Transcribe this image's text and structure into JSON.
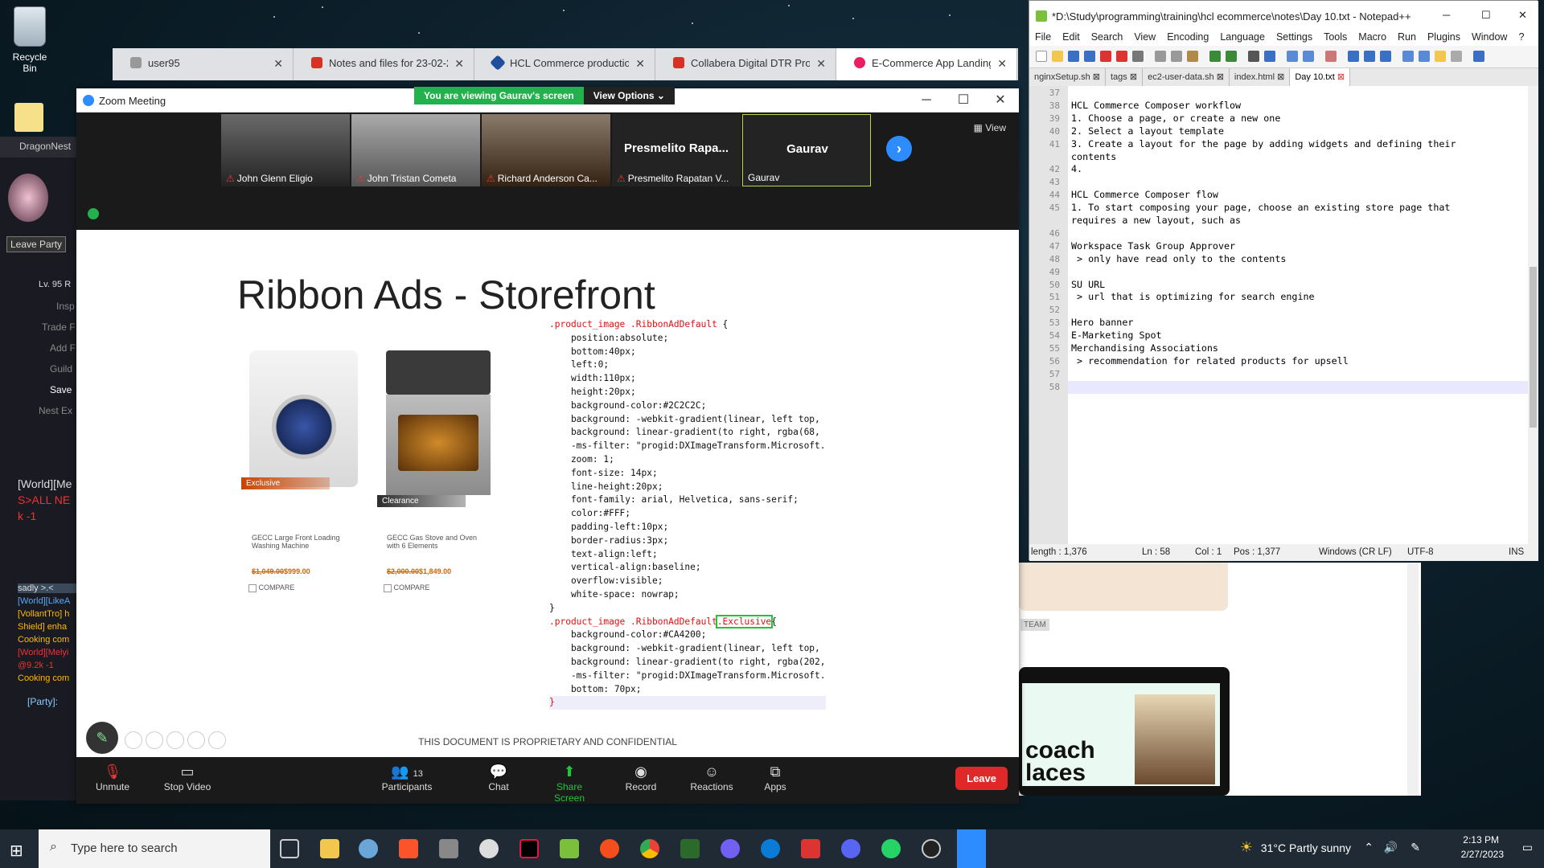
{
  "desktop": {
    "recycle_bin": "Recycle Bin",
    "dragonnest": "DragonNest"
  },
  "game": {
    "leave_party": "Leave Party",
    "level": "Lv. 95 R",
    "menu": [
      "Insp",
      "Trade F",
      "Add F",
      "Guild",
      "Save",
      "Nest Ex"
    ],
    "chat1": "[World][Me",
    "chat2": "S>ALL NE",
    "chat3": "k -1",
    "chat_lines": [
      "sadly >.<",
      "[World][LikeA",
      "[VollantTro] h",
      "Shield] enha",
      "Cooking com",
      "[World][Melyi",
      "@9.2k -1",
      "Cooking com"
    ],
    "party": "[Party]:"
  },
  "browser": {
    "tabs": [
      {
        "label": "user95",
        "color": "#999999"
      },
      {
        "label": "Notes and files for 23-02-2023",
        "color": "#d93025"
      },
      {
        "label": "HCL Commerce production en",
        "color": "#1f4e9c"
      },
      {
        "label": "Collabera Digital DTR Process",
        "color": "#d93025"
      },
      {
        "label": "E-Commerce App Landing He",
        "color": "#e91e63"
      }
    ]
  },
  "zoom": {
    "title": "Zoom Meeting",
    "viewing": "You are viewing Gaurav's screen",
    "view_options": "View Options",
    "view": "View",
    "participants": [
      {
        "name": "John Glenn Eligio",
        "muted": true
      },
      {
        "name": "John Tristan Cometa",
        "muted": true
      },
      {
        "name": "Richard Anderson Ca...",
        "muted": true
      },
      {
        "name": "Presmelito Rapatan V...",
        "big": "Presmelito  Rapa...",
        "muted": true
      },
      {
        "name": "Gaurav",
        "big": "Gaurav",
        "muted": false
      }
    ],
    "controls": {
      "unmute": "Unmute",
      "stop_video": "Stop Video",
      "participants": "Participants",
      "participants_count": "13",
      "chat": "Chat",
      "share_screen": "Share Screen",
      "record": "Record",
      "reactions": "Reactions",
      "apps": "Apps",
      "leave": "Leave"
    }
  },
  "slide": {
    "title": "Ribbon Ads - Storefront",
    "products": [
      {
        "ribbon": "Exclusive",
        "ribbon_color": "#CA4200",
        "name": "GECC Large Front Loading Washing Machine",
        "old_price": "$1,049.00",
        "price": "$999.00",
        "compare": "COMPARE"
      },
      {
        "ribbon": "Clearance",
        "ribbon_color": "#2C2C2C",
        "name": "GECC Gas Stove and Oven with 6 Elements",
        "old_price": "$2,000.00",
        "price": "$1,849.00",
        "compare": "COMPARE"
      }
    ],
    "code_lines": [
      {
        "sel": ".product_image .RibbonAdDefault",
        "rest": " {"
      },
      {
        "text": "    position:absolute;"
      },
      {
        "text": "    bottom:40px;"
      },
      {
        "text": "    left:0;"
      },
      {
        "text": "    width:110px;"
      },
      {
        "text": "    height:20px;"
      },
      {
        "text": "    background-color:#2C2C2C;"
      },
      {
        "text": "    background: -webkit-gradient(linear, left top,"
      },
      {
        "text": "    background: linear-gradient(to right, rgba(68,"
      },
      {
        "text": "    -ms-filter: \"progid:DXImageTransform.Microsoft."
      },
      {
        "text": "    zoom: 1;"
      },
      {
        "text": "    font-size: 14px;"
      },
      {
        "text": "    line-height:20px;"
      },
      {
        "text": "    font-family: arial, Helvetica, sans-serif;"
      },
      {
        "text": "    color:#FFF;"
      },
      {
        "text": "    padding-left:10px;"
      },
      {
        "text": "    border-radius:3px;"
      },
      {
        "text": "    text-align:left;"
      },
      {
        "text": "    vertical-align:baseline;"
      },
      {
        "text": "    overflow:visible;"
      },
      {
        "text": "    white-space: nowrap;"
      },
      {
        "text": "}"
      },
      {
        "sel": ".product_image .RibbonAdDefault",
        "ex": ".Exclusive",
        "rest": "{"
      },
      {
        "text": "    background-color:#CA4200;"
      },
      {
        "text": "    background: -webkit-gradient(linear, left top,"
      },
      {
        "text": "    background: linear-gradient(to right, rgba(202,"
      },
      {
        "text": "    -ms-filter: \"progid:DXImageTransform.Microsoft."
      },
      {
        "text": "    bottom: 70px;"
      },
      {
        "sel": "}",
        "rest": ""
      }
    ],
    "footer": "THIS DOCUMENT IS PROPRIETARY AND CONFIDENTIAL"
  },
  "background_page": {
    "team": "TEAM",
    "coach": "coach\nlaces"
  },
  "notepad": {
    "title": "*D:\\Study\\programming\\training\\hcl ecommerce\\notes\\Day 10.txt - Notepad++",
    "menu": [
      "File",
      "Edit",
      "Search",
      "View",
      "Encoding",
      "Language",
      "Settings",
      "Tools",
      "Macro",
      "Run",
      "Plugins",
      "Window",
      "?"
    ],
    "tabs": [
      {
        "label": "nginxSetup.sh",
        "active": false
      },
      {
        "label": "tags",
        "active": false
      },
      {
        "label": "ec2-user-data.sh",
        "active": false
      },
      {
        "label": "index.html",
        "active": false
      },
      {
        "label": "Day 10.txt",
        "active": true
      }
    ],
    "lines": [
      {
        "n": "37",
        "t": ""
      },
      {
        "n": "38",
        "t": "HCL Commerce Composer workflow"
      },
      {
        "n": "39",
        "t": "1. Choose a page, or create a new one"
      },
      {
        "n": "40",
        "t": "2. Select a layout template"
      },
      {
        "n": "41",
        "t": "3. Create a layout for the page by adding widgets and defining their"
      },
      {
        "n": "",
        "t": "contents"
      },
      {
        "n": "42",
        "t": "4."
      },
      {
        "n": "43",
        "t": ""
      },
      {
        "n": "44",
        "t": "HCL Commerce Composer flow"
      },
      {
        "n": "45",
        "t": "1. To start composing your page, choose an existing store page that"
      },
      {
        "n": "",
        "t": "requires a new layout, such as"
      },
      {
        "n": "46",
        "t": ""
      },
      {
        "n": "47",
        "t": "Workspace Task Group Approver"
      },
      {
        "n": "48",
        "t": " > only have read only to the contents"
      },
      {
        "n": "49",
        "t": ""
      },
      {
        "n": "50",
        "t": "SU URL"
      },
      {
        "n": "51",
        "t": " > url that is optimizing for search engine"
      },
      {
        "n": "52",
        "t": ""
      },
      {
        "n": "53",
        "t": "Hero banner"
      },
      {
        "n": "54",
        "t": "E-Marketing Spot"
      },
      {
        "n": "55",
        "t": "Merchandising Associations"
      },
      {
        "n": "56",
        "t": " > recommendation for related products for upsell"
      },
      {
        "n": "57",
        "t": ""
      },
      {
        "n": "58",
        "t": ""
      }
    ],
    "status": {
      "length": "length : 1,376",
      "ln": "Ln : 58",
      "col": "Col : 1",
      "pos": "Pos : 1,377",
      "eol": "Windows (CR LF)",
      "enc": "UTF-8",
      "mode": "INS"
    }
  },
  "taskbar": {
    "search": "Type here to search",
    "weather": "31°C  Partly sunny",
    "time": "2:13 PM",
    "date": "2/27/2023"
  }
}
